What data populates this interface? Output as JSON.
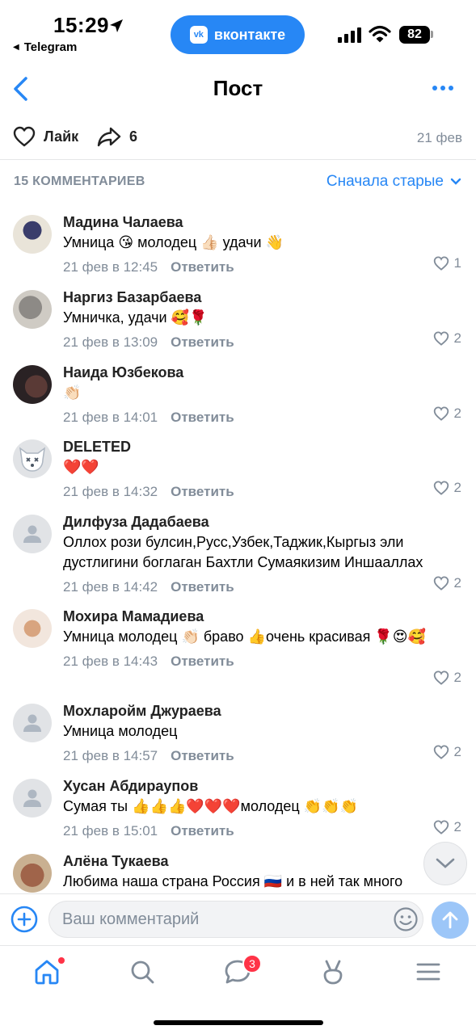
{
  "status_bar": {
    "time": "15:29",
    "back_app": "Telegram",
    "vk_pill": "вконтакте",
    "vk_logo": "vk",
    "battery": "82"
  },
  "nav": {
    "title": "Пост"
  },
  "post": {
    "like_label": "Лайк",
    "share_count": "6",
    "date": "21 фев"
  },
  "comments_header": {
    "count": "15 КОММЕНТАРИЕВ",
    "sort": "Сначала старые"
  },
  "comments": [
    {
      "author": "Мадина Чалаева",
      "text": "Умница 😘 молодец 👍🏻 удачи 👋",
      "time": "21 фев в 12:45",
      "reply": "Ответить",
      "likes": "1",
      "avatar": "photo"
    },
    {
      "author": "Наргиз Базарбаева",
      "text": "Умничка, удачи 🥰🌹",
      "time": "21 фев в 13:09",
      "reply": "Ответить",
      "likes": "2",
      "avatar": "photo"
    },
    {
      "author": "Наида Юзбекова",
      "text": "👏🏻",
      "time": "21 фев в 14:01",
      "reply": "Ответить",
      "likes": "2",
      "avatar": "photo"
    },
    {
      "author": "DELETED",
      "text": "❤️❤️",
      "time": "21 фев в 14:32",
      "reply": "Ответить",
      "likes": "2",
      "avatar": "deleted-dog"
    },
    {
      "author": "Дилфуза Дадабаева",
      "text": "Оллох рози булсин,Русс,Узбек,Таджик,Кыргыз эли дустлигини боглаган Бахтли  Сумаякизим Иншааллах",
      "time": "21 фев в 14:42",
      "reply": "Ответить",
      "likes": "2",
      "avatar": "placeholder"
    },
    {
      "author": "Мохира Мамадиева",
      "text": "Умница молодец 👏🏻 браво 👍очень красивая 🌹😍🥰",
      "time": "21 фев в 14:43",
      "reply": "Ответить",
      "likes": "2",
      "avatar": "photo"
    },
    {
      "author": "Мохларойм Джураева",
      "text": "Умница молодец",
      "time": "21 фев в 14:57",
      "reply": "Ответить",
      "likes": "2",
      "avatar": "placeholder"
    },
    {
      "author": "Хусан Абдираупов",
      "text": "Сумая ты 👍👍👍❤️❤️❤️молодец 👏👏👏",
      "time": "21 фев в 15:01",
      "reply": "Ответить",
      "likes": "2",
      "avatar": "placeholder"
    },
    {
      "author": "Алёна Тукаева",
      "text": "Любима наша страна Россия 🇷🇺 и в ней так много",
      "avatar": "photo"
    }
  ],
  "composer": {
    "placeholder": "Ваш комментарий"
  },
  "tabbar": {
    "messages_badge": "3",
    "tabs": [
      "home-icon",
      "search-icon",
      "messages-icon",
      "clips-icon",
      "menu-icon"
    ]
  },
  "colors": {
    "accent": "#2787f5",
    "secondary_text": "#818c99",
    "badge": "#ff3347"
  }
}
